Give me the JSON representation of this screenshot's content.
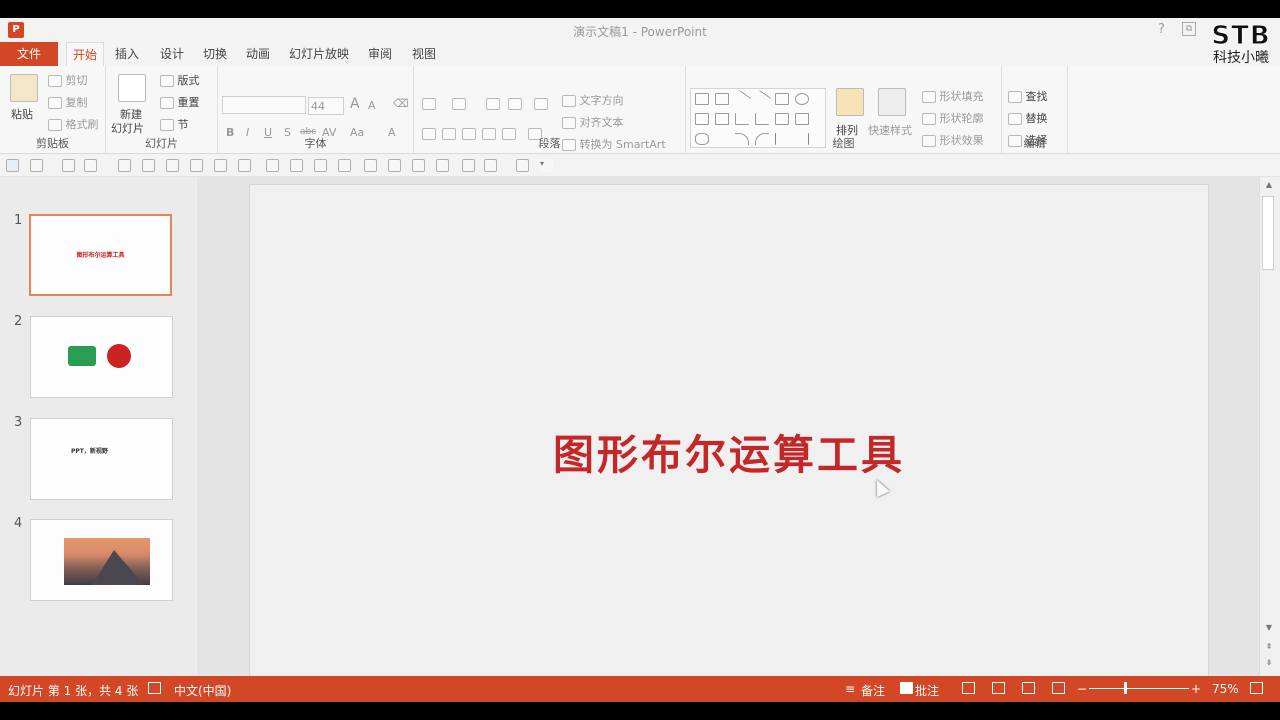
{
  "window": {
    "title": "演示文稿1 - PowerPoint",
    "logo": "P",
    "help": "?",
    "restore": "⧉"
  },
  "tabs": [
    {
      "label": "文件"
    },
    {
      "label": "开始"
    },
    {
      "label": "插入"
    },
    {
      "label": "设计"
    },
    {
      "label": "切换"
    },
    {
      "label": "动画"
    },
    {
      "label": "幻灯片放映"
    },
    {
      "label": "审阅"
    },
    {
      "label": "视图"
    }
  ],
  "ribbon": {
    "clipboard": {
      "label": "剪贴板",
      "paste": "粘贴",
      "cut": "剪切",
      "copy": "复制",
      "format_painter": "格式刷"
    },
    "slides": {
      "label": "幻灯片",
      "new_slide_1": "新建",
      "new_slide_2": "幻灯片",
      "layout": "版式",
      "reset": "重置",
      "section": "节"
    },
    "font": {
      "label": "字体",
      "size": "44",
      "bold": "B",
      "italic": "I",
      "underline": "U",
      "shadow": "S",
      "strike": "abc",
      "spacing": "AV",
      "case": "Aa",
      "color": "A",
      "grow": "A",
      "shrink": "A"
    },
    "paragraph": {
      "label": "段落",
      "text_direction": "文字方向",
      "align_text": "对齐文本",
      "smartart": "转换为 SmartArt"
    },
    "drawing": {
      "label": "绘图",
      "arrange": "排列",
      "quick_styles": "快速样式",
      "shape_fill": "形状填充",
      "shape_outline": "形状轮廓",
      "shape_effects": "形状效果"
    },
    "editing": {
      "label": "编辑",
      "find": "查找",
      "replace": "替换",
      "select": "选择"
    }
  },
  "slides": [
    {
      "num": "1",
      "title": "图形布尔运算工具"
    },
    {
      "num": "2"
    },
    {
      "num": "3",
      "title": "PPT，新视野"
    },
    {
      "num": "4"
    }
  ],
  "canvas": {
    "title": "图形布尔运算工具"
  },
  "status": {
    "slide_info": "幻灯片 第 1 张，共 4 张",
    "language": "中文(中国)",
    "notes": "备注",
    "comments": "批注",
    "zoom": "75%",
    "minus": "−",
    "plus": "+"
  },
  "watermark": {
    "logo": "STB",
    "sub": "科技小曦"
  },
  "colors": {
    "accent": "#d24726",
    "title_red": "#c42727",
    "green": "#2a9d55"
  }
}
